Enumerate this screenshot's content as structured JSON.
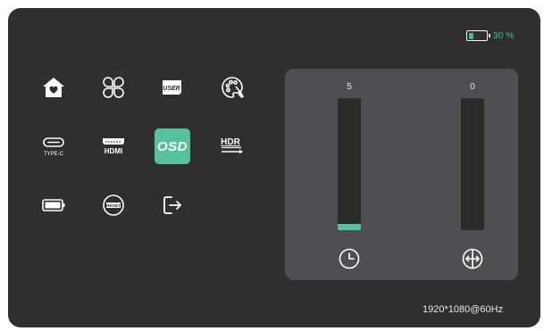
{
  "battery": {
    "percent_label": "30 %",
    "level": 0.3,
    "fill_color": "#3fbf93"
  },
  "menu": {
    "rows": [
      [
        {
          "name": "home-icon"
        },
        {
          "name": "layout-icon"
        },
        {
          "name": "user-mode-icon",
          "label": "USER"
        },
        {
          "name": "color-palette-icon"
        }
      ],
      [
        {
          "name": "usb-type-c-icon",
          "label": "TYPE-C"
        },
        {
          "name": "hdmi-icon",
          "label": "HDMI"
        },
        {
          "name": "osd-icon",
          "label": "OSD",
          "active": true
        },
        {
          "name": "hdr-icon",
          "label": "HDR"
        }
      ],
      [
        {
          "name": "battery-icon"
        },
        {
          "name": "reset-icon",
          "label": "RESET"
        },
        {
          "name": "exit-icon"
        }
      ]
    ],
    "active_color": "#56c19e"
  },
  "panel": {
    "sliders": [
      {
        "value": 5,
        "value_label": "5",
        "max": 100,
        "icon": "clock-icon"
      },
      {
        "value": 0,
        "value_label": "0",
        "max": 100,
        "icon": "horizontal-position-icon"
      }
    ]
  },
  "resolution": "1920*1080@60Hz"
}
